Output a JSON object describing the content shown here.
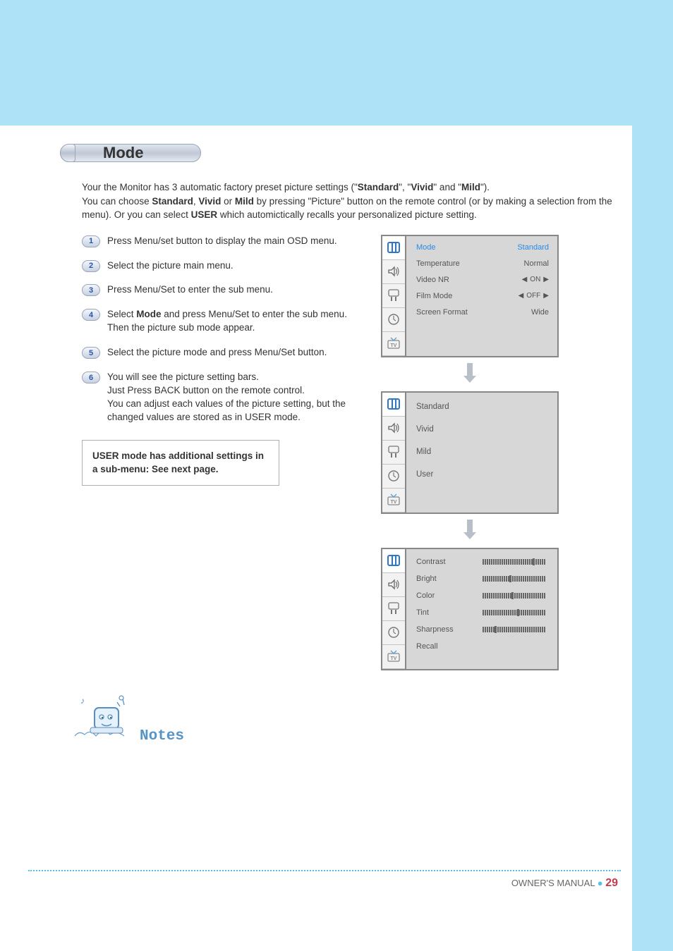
{
  "section_title": "Mode",
  "intro": {
    "line1_a": "Your the Monitor has 3 automatic factory preset picture settings (\"",
    "bold1": "Standard",
    "line1_b": "\", \"",
    "bold2": "Vivid",
    "line1_c": "\" and \"",
    "bold3": "Mild",
    "line1_d": "\").",
    "line2_a": "You can choose ",
    "bold4": "Standard",
    "line2_b": ", ",
    "bold5": "Vivid",
    "line2_c": " or ",
    "bold6": "Mild",
    "line2_d": " by pressing \"Picture\" button on the remote control (or by making a selection from the menu). Or you can select ",
    "bold7": "USER",
    "line2_e": " which automictically recalls your personalized picture setting."
  },
  "steps": [
    {
      "n": "1",
      "text_a": "Press Menu/set button to display the main OSD menu."
    },
    {
      "n": "2",
      "text_a": "Select the picture main menu."
    },
    {
      "n": "3",
      "text_a": "Press Menu/Set to enter the sub menu."
    },
    {
      "n": "4",
      "text_a": "Select ",
      "bold": "Mode",
      "text_b": " and press Menu/Set to enter the sub menu. Then the picture sub   mode appear."
    },
    {
      "n": "5",
      "text_a": "Select the picture mode and press Menu/Set button."
    },
    {
      "n": "6",
      "text_a": "You will see the picture setting bars.\nJust Press BACK button on the remote control.\nYou can adjust each values of the picture setting, but the changed values are stored as in USER mode."
    }
  ],
  "note_box": "USER mode has additional settings in a sub-menu: See next page.",
  "osd1": {
    "rows": [
      {
        "label": "Mode",
        "value": "Standard",
        "highlight": true
      },
      {
        "label": "Temperature",
        "value": "Normal"
      },
      {
        "label": "Video NR",
        "value": "ON",
        "arrows": true
      },
      {
        "label": "Film Mode",
        "value": "OFF",
        "arrows": true
      },
      {
        "label": "Screen Format",
        "value": "Wide"
      }
    ]
  },
  "osd2": {
    "items": [
      "Standard",
      "Vivid",
      "Mild",
      "User"
    ]
  },
  "osd3": {
    "rows": [
      {
        "label": "Contrast",
        "pos": 75
      },
      {
        "label": "Bright",
        "pos": 40
      },
      {
        "label": "Color",
        "pos": 44
      },
      {
        "label": "Tint",
        "pos": 52
      },
      {
        "label": "Sharpness",
        "pos": 18
      },
      {
        "label": "Recall"
      }
    ]
  },
  "notes_label": "Notes",
  "footer": {
    "label": "OWNER'S MANUAL",
    "page": "29"
  }
}
